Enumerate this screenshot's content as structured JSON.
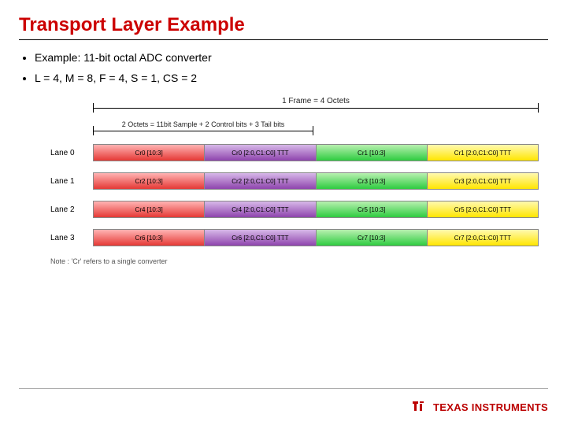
{
  "title": "Transport Layer Example",
  "bullets": [
    "Example: 11-bit octal ADC converter",
    "L = 4, M = 8, F = 4, S = 1, CS = 2"
  ],
  "frame_label": "1 Frame = 4 Octets",
  "octet_label": "2 Octets = 11bit Sample + 2 Control bits + 3 Tail bits",
  "lanes": [
    {
      "label": "Lane 0",
      "cells": [
        {
          "text": "Cr0 [10:3]",
          "color": "red"
        },
        {
          "text": "Cr0 [2:0,C1:C0] TTT",
          "color": "purple"
        },
        {
          "text": "Cr1 [10:3]",
          "color": "green"
        },
        {
          "text": "Cr1 [2:0,C1:C0] TTT",
          "color": "yellow"
        }
      ]
    },
    {
      "label": "Lane 1",
      "cells": [
        {
          "text": "Cr2 [10:3]",
          "color": "red"
        },
        {
          "text": "Cr2 [2:0,C1:C0] TTT",
          "color": "purple"
        },
        {
          "text": "Cr3 [10:3]",
          "color": "green"
        },
        {
          "text": "Cr3 [2:0,C1:C0] TTT",
          "color": "yellow"
        }
      ]
    },
    {
      "label": "Lane 2",
      "cells": [
        {
          "text": "Cr4 [10:3]",
          "color": "red"
        },
        {
          "text": "Cr4 [2:0,C1:C0] TTT",
          "color": "purple"
        },
        {
          "text": "Cr5 [10:3]",
          "color": "green"
        },
        {
          "text": "Cr5 [2:0,C1:C0] TTT",
          "color": "yellow"
        }
      ]
    },
    {
      "label": "Lane 3",
      "cells": [
        {
          "text": "Cr6 [10:3]",
          "color": "red"
        },
        {
          "text": "Cr6 [2:0,C1:C0] TTT",
          "color": "purple"
        },
        {
          "text": "Cr7 [10:3]",
          "color": "green"
        },
        {
          "text": "Cr7 [2:0,C1:C0] TTT",
          "color": "yellow"
        }
      ]
    }
  ],
  "note": "Note :  'Cr' refers to a single converter",
  "logo_text": "TEXAS INSTRUMENTS"
}
